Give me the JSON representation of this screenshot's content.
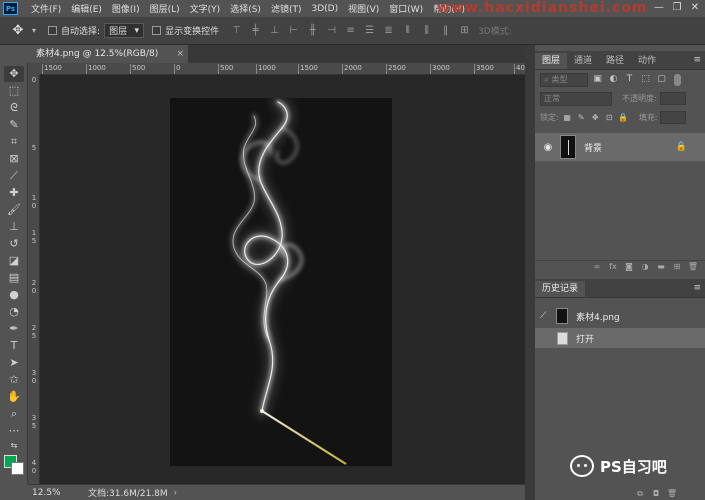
{
  "app": {
    "logo": "Ps"
  },
  "menu": [
    "文件(F)",
    "编辑(E)",
    "图像(I)",
    "图层(L)",
    "文字(Y)",
    "选择(S)",
    "滤镜(T)",
    "3D(D)",
    "视图(V)",
    "窗口(W)",
    "帮助(H)"
  ],
  "watermark": "www.hacxidianshei.com",
  "options": {
    "auto_select_label": "自动选择:",
    "auto_select_value": "图层",
    "show_transform_label": "显示变换控件",
    "mode_3d_label": "3D模式:"
  },
  "document": {
    "tab_title": "素材4.png @ 12.5%(RGB/8)",
    "zoom": "12.5%",
    "info": "文档:31.6M/21.8M"
  },
  "ruler": {
    "top": [
      "1500",
      "1000",
      "500",
      "0",
      "500",
      "1000",
      "1500",
      "2000",
      "2500",
      "3000",
      "3500",
      "40"
    ],
    "left": [
      "0",
      "5",
      "1",
      "0",
      "1",
      "5",
      "2",
      "0",
      "2",
      "5",
      "3",
      "0",
      "3",
      "5",
      "4",
      "0"
    ]
  },
  "layers_panel": {
    "tabs": [
      "图层",
      "通道",
      "路径",
      "动作"
    ],
    "search_placeholder": "类型",
    "blend_mode": "正常",
    "opacity_label": "不透明度:",
    "lock_label": "锁定:",
    "fill_label": "填充:",
    "layer_name": "背景"
  },
  "history_panel": {
    "title": "历史记录",
    "snapshot": "素材4.png",
    "state": "打开"
  },
  "branding": {
    "wechat_name": "PS自习吧"
  },
  "colors": {
    "foreground": "#00a651",
    "background": "#ffffff",
    "watermark": "#c0392b"
  }
}
